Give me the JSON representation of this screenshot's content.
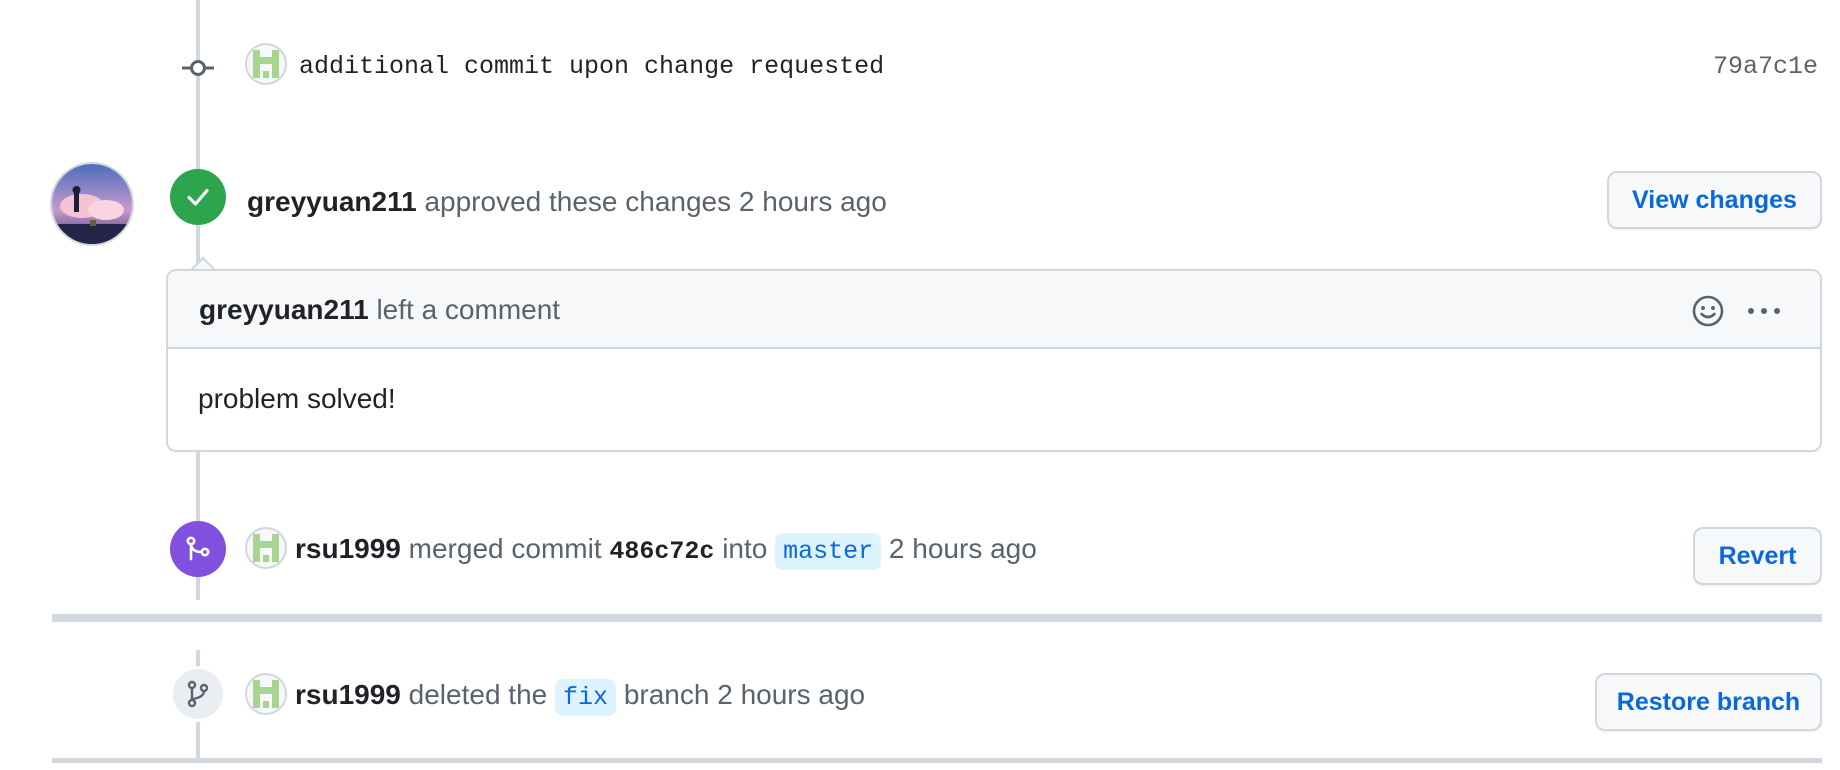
{
  "commit_event": {
    "message": "additional commit upon change requested",
    "sha": "79a7c1e",
    "icon": "git-commit-icon"
  },
  "review_event": {
    "author": "greyyuan211",
    "action": "approved these changes",
    "time": "2 hours ago",
    "button_label": "View changes",
    "badge_color": "#2da44e",
    "icon": "check-icon"
  },
  "review_comment": {
    "author": "greyyuan211",
    "action": "left a comment",
    "body": "problem solved!",
    "reaction_icon": "smiley-icon",
    "menu_icon": "kebab-horizontal-icon"
  },
  "merge_event": {
    "author": "rsu1999",
    "action": "merged commit",
    "commit": "486c72c",
    "into_word": "into",
    "branch": "master",
    "time": "2 hours ago",
    "button_label": "Revert",
    "badge_color": "#8250df",
    "icon": "git-merge-icon"
  },
  "delete_event": {
    "author": "rsu1999",
    "action_before": "deleted the",
    "branch": "fix",
    "action_after": "branch",
    "time": "2 hours ago",
    "button_label": "Restore branch",
    "icon": "git-branch-icon"
  },
  "colors": {
    "link_blue": "#0969da",
    "border": "#d0d7de",
    "muted_text": "#59636e",
    "chip_bg": "#ddf4ff"
  }
}
